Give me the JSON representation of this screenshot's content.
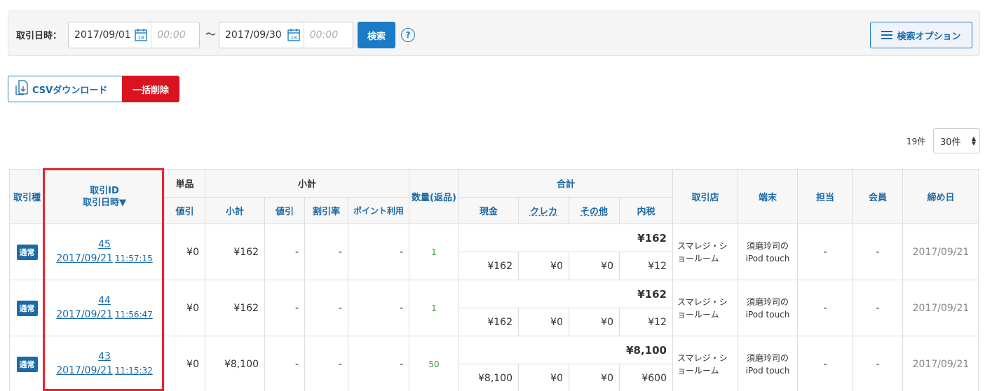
{
  "search": {
    "label": "取引日時：",
    "date_from": "2017/09/01",
    "time_from_placeholder": "00:00",
    "tilde": "〜",
    "date_to": "2017/09/30",
    "time_to_placeholder": "00:00",
    "search_button": "検索",
    "help": "?",
    "options_button": "検索オプション"
  },
  "actions": {
    "csv_button": "CSVダウンロード",
    "bulk_delete_button": "一括削除"
  },
  "pagination": {
    "count": "19件",
    "per_page": "30件"
  },
  "table": {
    "headers": {
      "type": "取引種",
      "id": "取引ID",
      "datetime": "取引日時▼",
      "unit": "単品",
      "subtotal_group": "小計",
      "quantity": "数量(返品)",
      "total_group": "合計",
      "store": "取引店",
      "terminal": "端末",
      "staff": "担当",
      "member": "会員",
      "closing": "締め日",
      "unit_discount": "値引",
      "subtotal": "小計",
      "sub_discount": "値引",
      "discount_rate": "割引率",
      "point_usage": "ポイント利用",
      "cash": "現金",
      "credit": "クレカ",
      "other": "その他",
      "tax": "内税"
    },
    "rows": [
      {
        "type": "通常",
        "id": "45",
        "date": "2017/09/21",
        "time": "11:57:15",
        "unit_discount": "¥0",
        "subtotal": "¥162",
        "sub_discount": "-",
        "discount_rate": "-",
        "point_usage": "-",
        "quantity": "1",
        "total": "¥162",
        "cash": "¥162",
        "credit": "¥0",
        "other": "¥0",
        "tax": "¥12",
        "store": "スマレジ・ショールーム",
        "terminal": "須磨玲司の iPod touch",
        "staff": "-",
        "member": "-",
        "closing": "2017/09/21"
      },
      {
        "type": "通常",
        "id": "44",
        "date": "2017/09/21",
        "time": "11:56:47",
        "unit_discount": "¥0",
        "subtotal": "¥162",
        "sub_discount": "-",
        "discount_rate": "-",
        "point_usage": "-",
        "quantity": "1",
        "total": "¥162",
        "cash": "¥162",
        "credit": "¥0",
        "other": "¥0",
        "tax": "¥12",
        "store": "スマレジ・ショールーム",
        "terminal": "須磨玲司の iPod touch",
        "staff": "-",
        "member": "-",
        "closing": "2017/09/21"
      },
      {
        "type": "通常",
        "id": "43",
        "date": "2017/09/21",
        "time": "11:15:32",
        "unit_discount": "¥0",
        "subtotal": "¥8,100",
        "sub_discount": "-",
        "discount_rate": "-",
        "point_usage": "-",
        "quantity": "50",
        "total": "¥8,100",
        "cash": "¥8,100",
        "credit": "¥0",
        "other": "¥0",
        "tax": "¥600",
        "store": "スマレジ・ショールーム",
        "terminal": "須磨玲司の iPod touch",
        "staff": "-",
        "member": "-",
        "closing": "2017/09/21"
      }
    ]
  },
  "colors": {
    "accent": "#1a7cc7",
    "danger": "#d9131f",
    "highlight": "#e8262f",
    "quantity": "#3b9a3b"
  }
}
